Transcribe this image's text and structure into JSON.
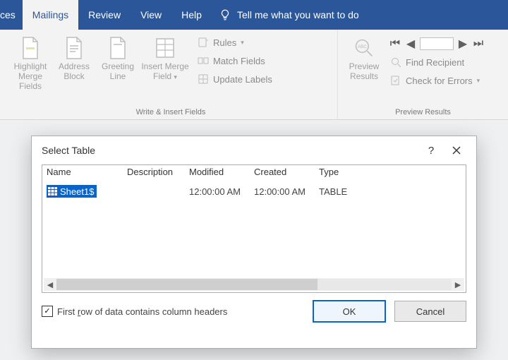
{
  "tabs": {
    "partial": "ces",
    "items": [
      "Mailings",
      "Review",
      "View",
      "Help"
    ],
    "tell_me": "Tell me what you want to do"
  },
  "ribbon": {
    "write_group": {
      "label": "Write & Insert Fields",
      "highlight": "Highlight Merge Fields",
      "address": "Address Block",
      "greeting": "Greeting Line",
      "insert_merge": "Insert Merge Field",
      "rules": "Rules",
      "match_fields": "Match Fields",
      "update_labels": "Update Labels"
    },
    "preview_group": {
      "label": "Preview Results",
      "preview": "Preview Results",
      "find_recipient": "Find Recipient",
      "check_errors": "Check for Errors"
    }
  },
  "dialog": {
    "title": "Select Table",
    "help": "?",
    "columns": {
      "name": "Name",
      "desc": "Description",
      "mod": "Modified",
      "crt": "Created",
      "type": "Type"
    },
    "rows": [
      {
        "name": "Sheet1$",
        "desc": "",
        "mod": "12:00:00 AM",
        "crt": "12:00:00 AM",
        "type": "TABLE"
      }
    ],
    "first_row_label": "First row of data contains column headers",
    "ok": "OK",
    "cancel": "Cancel"
  }
}
